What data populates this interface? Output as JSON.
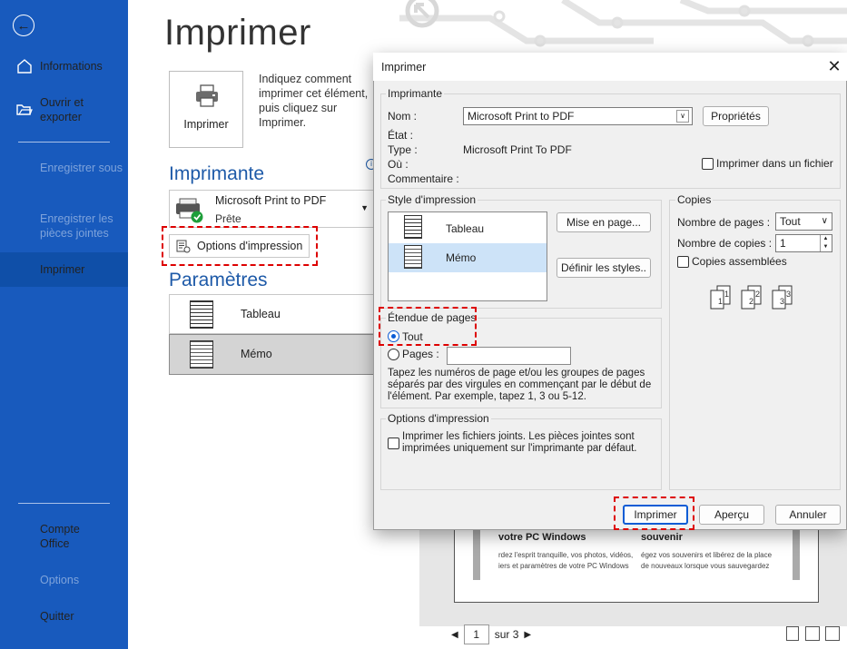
{
  "sidebar": {
    "items": [
      {
        "label": "Informations"
      },
      {
        "label": "Ouvrir et exporter"
      },
      {
        "label": "Enregistrer sous"
      },
      {
        "label": "Enregistrer les pièces jointes"
      },
      {
        "label": "Imprimer"
      },
      {
        "label": "Compte Office"
      },
      {
        "label": "Options"
      },
      {
        "label": "Quitter"
      }
    ]
  },
  "main": {
    "title": "Imprimer",
    "print_button_label": "Imprimer",
    "print_description": "Indiquez comment imprimer cet élément, puis cliquez sur Imprimer.",
    "printer_heading": "Imprimante",
    "printer_name": "Microsoft Print to PDF",
    "printer_status": "Prête",
    "options_button": "Options d'impression",
    "settings_heading": "Paramètres",
    "styles": [
      {
        "label": "Tableau"
      },
      {
        "label": "Mémo"
      }
    ]
  },
  "preview": {
    "col1_title": "votre PC Windows",
    "col1_text": "rdez l'esprit tranquille, vos photos, vidéos, iers et paramètres de votre PC Windows",
    "col2_title": "souvenir",
    "col2_text": "égez vos souvenirs et libérez de la place de nouveaux lorsque vous sauvegardez",
    "page_value": "1",
    "page_total": "sur 3"
  },
  "dialog": {
    "title": "Imprimer",
    "printer_group": "Imprimante",
    "name_label": "Nom :",
    "name_value": "Microsoft Print to PDF",
    "properties_button": "Propriétés",
    "state_label": "État :",
    "type_label": "Type :",
    "type_value": "Microsoft Print To PDF",
    "where_label": "Où :",
    "comment_label": "Commentaire :",
    "print_to_file": "Imprimer dans un fichier",
    "style_group": "Style d'impression",
    "styles": [
      {
        "label": "Tableau"
      },
      {
        "label": "Mémo"
      }
    ],
    "page_setup_button": "Mise en page...",
    "define_styles_button": "Définir les styles..",
    "copies_group": "Copies",
    "pages_count_label": "Nombre de pages :",
    "pages_count_value": "Tout",
    "copies_count_label": "Nombre de copies :",
    "copies_count_value": "1",
    "collate_label": "Copies assemblées",
    "range_group": "Étendue de pages",
    "range_all": "Tout",
    "range_pages": "Pages :",
    "range_help": "Tapez les numéros de page et/ou les groupes de pages séparés par des virgules en commençant par le début de l'élément. Par exemple, tapez 1, 3 ou 5-12.",
    "options_group": "Options d'impression",
    "attachments_label": "Imprimer les fichiers joints. Les pièces jointes sont imprimées uniquement sur l'imprimante par défaut.",
    "print_button": "Imprimer",
    "preview_button": "Aperçu",
    "cancel_button": "Annuler"
  },
  "colors": {
    "sidebar": "#185abd",
    "accent": "#1e5aa8",
    "highlight": "#dd0000"
  }
}
